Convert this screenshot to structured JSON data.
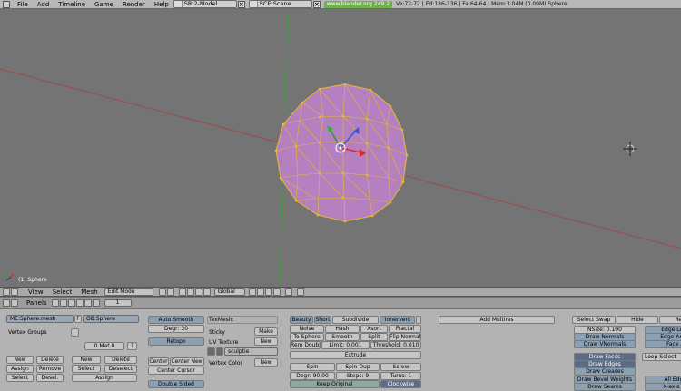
{
  "menubar": {
    "items": [
      "File",
      "Add",
      "Timeline",
      "Game",
      "Render",
      "Help"
    ],
    "screen": "SR:2-Model",
    "scene": "SCE:Scene",
    "url": "www.blender.org 249.2",
    "stats": "Ve:72-72 | Ed:136-136 | Fa:64-64 | Mem:3.04M (0.09M) Sphere"
  },
  "viewport": {
    "label": "(1) Sphere",
    "colors": {
      "bg": "#747474",
      "mesh_fill": "#b580c0",
      "edge": "#e8b830",
      "axis_x": "#a04a4a",
      "axis_y": "#3e9a3e"
    }
  },
  "header3d": {
    "menus": [
      "View",
      "Select",
      "Mesh"
    ],
    "mode": "Edit Mode",
    "orientation": "Global"
  },
  "buttons_header": {
    "panels": "Panels",
    "page": "1"
  },
  "link": {
    "mesh": "ME:Sphere.mesh",
    "f": "F",
    "object": "OB:Sphere",
    "vertex_groups": "Vertex Groups",
    "mat": "0 Mat 0",
    "question": "?",
    "new": "New",
    "delete": "Delete",
    "assign": "Assign",
    "remove": "Remove",
    "select": "Select",
    "deselect_short": "Desel.",
    "deselect": "Deselect"
  },
  "mesh": {
    "auto_smooth": "Auto Smooth",
    "degr": "Degr: 30",
    "retopo": "Retopo",
    "center": "Center",
    "center_new": "Center New",
    "center_cursor": "Center Cursor",
    "double_sided": "Double Sided",
    "texmesh": "TexMesh:",
    "sticky": "Sticky",
    "make": "Make",
    "uv_texture": "UV Texture",
    "new": "New",
    "sculptie": "sculptie",
    "vertex_color": "Vertex Color"
  },
  "tools": {
    "beauty": "Beauty",
    "short": "Short",
    "subdivide": "Subdivide",
    "innervert": "Innervert",
    "noise": "Noise",
    "hash": "Hash",
    "xsort": "Xsort",
    "fractal": "Fractal",
    "to_sphere": "To Sphere",
    "smooth": "Smooth",
    "split": "Split",
    "flip_normals": "Flip Normals",
    "rem_double": "Rem Double",
    "limit": "Limit: 0.001",
    "threshold": "Threshold: 0.010",
    "extrude": "Extrude",
    "spin": "Spin",
    "spin_dup": "Spin Dup",
    "screw": "Screw",
    "degr": "Degr: 90.00",
    "steps": "Steps: 9",
    "turns": "Turns: 1",
    "keep_original": "Keep Original",
    "clockwise": "Clockwise"
  },
  "multires": {
    "add": "Add Multires"
  },
  "tools_more": {
    "select_swap": "Select Swap",
    "hide": "Hide",
    "reveal": "Re",
    "nsize": "NSize: 0.100",
    "draw_normals": "Draw Normals",
    "draw_vnormals": "Draw VNormals",
    "draw_faces": "Draw Faces",
    "draw_edges": "Draw Edges",
    "draw_creases": "Draw Creases",
    "draw_bevel_weights": "Draw Bevel Weights",
    "draw_seams": "Draw Seams",
    "edge_len": "Edge Len",
    "edge_ang": "Edge Ang",
    "face_ar": "Face Ar",
    "loop_select": "Loop Select",
    "all_edges": "All Edge",
    "x_axis": "X-axis m"
  }
}
